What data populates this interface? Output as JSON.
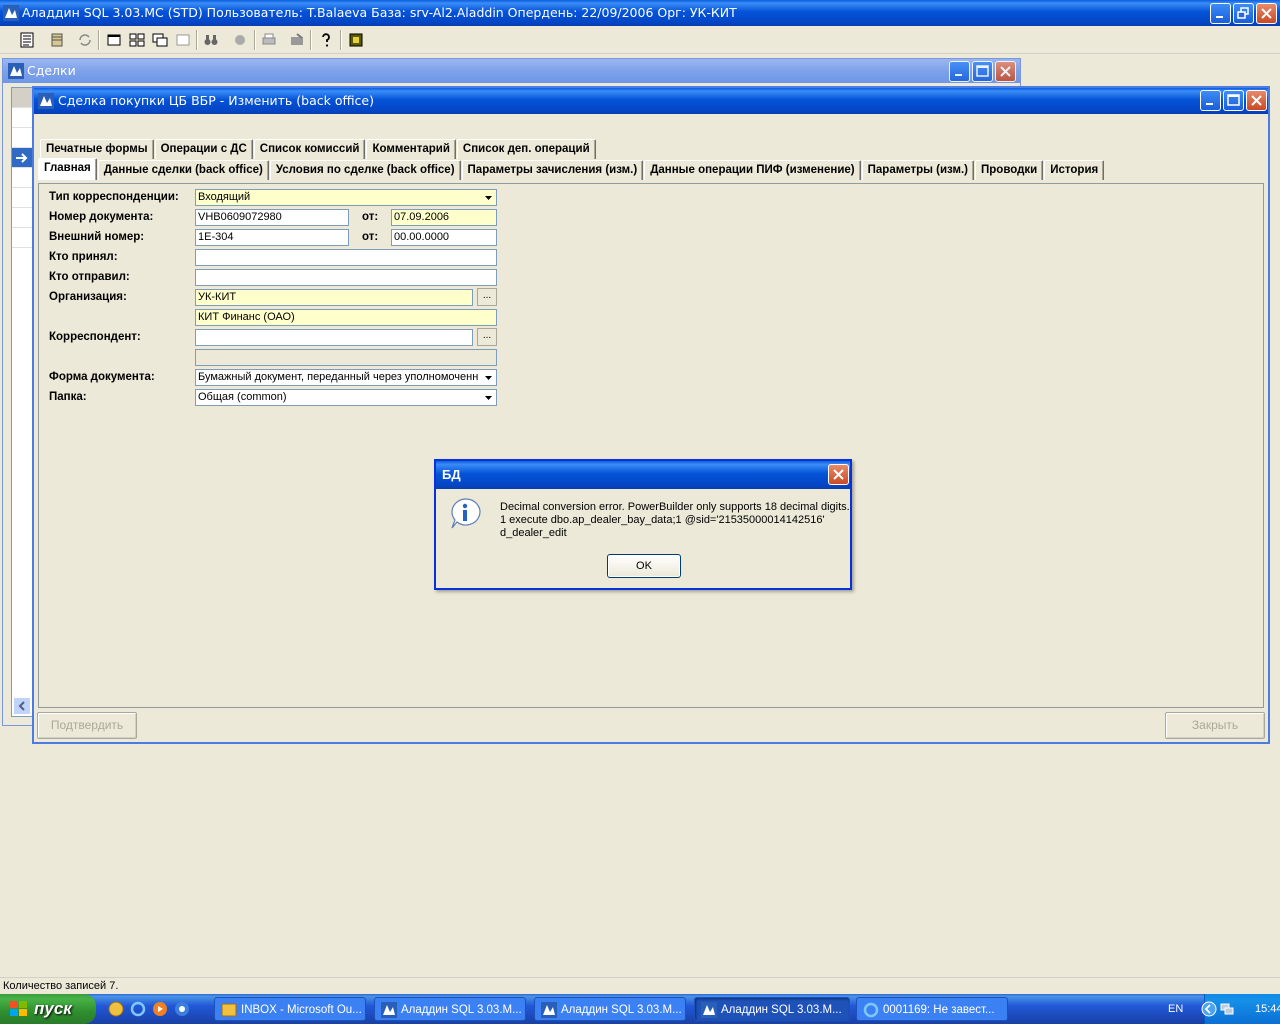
{
  "app": {
    "title": "Аладдин SQL 3.03.MC (STD)  Пользователь: T.Balaeva База: srv-Al2.Aladdin Опердень: 22/09/2006 Орг: УК-КИТ"
  },
  "deals_window": {
    "title": "Сделки"
  },
  "edit_window": {
    "title": "Сделка покупки ЦБ ВБР - Изменить (back office)",
    "tabs_row1": [
      "Печатные формы",
      "Операции с ДС",
      "Список комиссий",
      "Комментарий",
      "Список деп. операций"
    ],
    "tabs_row2": [
      "Главная",
      "Данные сделки (back office)",
      "Условия по сделке (back office)",
      "Параметры зачисления (изм.)",
      "Данные операции ПИФ (изменение)",
      "Параметры (изм.)",
      "Проводки",
      "История"
    ],
    "active_tab": "Главная",
    "form": {
      "corr_type_label": "Тип корреспонденции:",
      "corr_type_value": "Входящий",
      "doc_number_label": "Номер документа:",
      "doc_number_value": "VHB0609072980",
      "from_label": "от:",
      "doc_date_value": "07.09.2006",
      "ext_number_label": "Внешний номер:",
      "ext_number_value": "1E-304",
      "ext_date_value": "00.00.0000",
      "received_by_label": "Кто принял:",
      "received_by_value": "",
      "sent_by_label": "Кто отправил:",
      "sent_by_value": "",
      "org_label": "Организация:",
      "org_code_value": "УК-КИТ",
      "org_name_value": "КИТ Финанс (ОАО)",
      "correspondent_label": "Корреспондент:",
      "correspondent_value": "",
      "correspondent_name_value": "",
      "doc_form_label": "Форма документа:",
      "doc_form_value": "Бумажный документ, переданный через уполномоченн",
      "folder_label": "Папка:",
      "folder_value": "Общая  (common)",
      "ellipsis": "..."
    },
    "confirm_button": "Подтвердить",
    "close_button": "Закрыть"
  },
  "dialog": {
    "title": "БД",
    "line1": "Decimal conversion error.  PowerBuilder only supports 18 decimal digits.",
    "line2": "1 execute dbo.ap_dealer_bay_data;1 @sid='21535000014142516'",
    "line3": "d_dealer_edit",
    "ok": "OK"
  },
  "status": {
    "text": "Количество записей 7."
  },
  "taskbar": {
    "start": "пуск",
    "tasks": [
      "INBOX - Microsoft Ou...",
      "Аладдин SQL 3.03.M...",
      "Аладдин SQL 3.03.M...",
      "Аладдин SQL 3.03.M...",
      "0001169: Не завест..."
    ],
    "lang": "EN",
    "clock": "15:44"
  },
  "colors": {
    "xp_blue": "#0553d8",
    "field_yellow": "#ffffcc",
    "selection": "#316ac5"
  }
}
